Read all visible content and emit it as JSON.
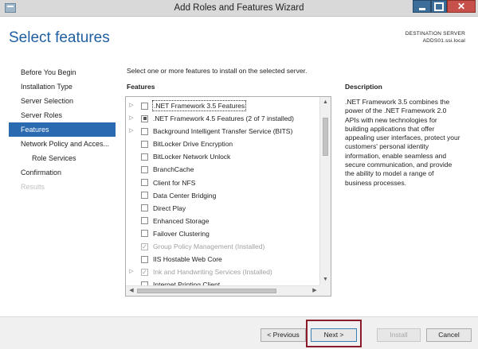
{
  "window": {
    "title": "Add Roles and Features Wizard",
    "close_glyph": "✕"
  },
  "header": {
    "title": "Select features",
    "destination_label": "DESTINATION SERVER",
    "destination_server": "ADDS01.ssi.local"
  },
  "nav": {
    "items": [
      {
        "label": "Before You Begin",
        "state": "normal"
      },
      {
        "label": "Installation Type",
        "state": "normal"
      },
      {
        "label": "Server Selection",
        "state": "normal"
      },
      {
        "label": "Server Roles",
        "state": "normal"
      },
      {
        "label": "Features",
        "state": "selected"
      },
      {
        "label": "Network Policy and Acces...",
        "state": "normal"
      },
      {
        "label": "Role Services",
        "state": "sub"
      },
      {
        "label": "Confirmation",
        "state": "normal"
      },
      {
        "label": "Results",
        "state": "disabled"
      }
    ]
  },
  "main": {
    "instruction": "Select one or more features to install on the selected server.",
    "features_heading": "Features",
    "features": [
      {
        "label": ".NET Framework 3.5 Features",
        "expandable": true,
        "check": "none",
        "focused": true,
        "installed": false
      },
      {
        "label": ".NET Framework 4.5 Features (2 of 7 installed)",
        "expandable": true,
        "check": "partial",
        "focused": false,
        "installed": false
      },
      {
        "label": "Background Intelligent Transfer Service (BITS)",
        "expandable": true,
        "check": "none",
        "focused": false,
        "installed": false
      },
      {
        "label": "BitLocker Drive Encryption",
        "expandable": false,
        "check": "none",
        "focused": false,
        "installed": false
      },
      {
        "label": "BitLocker Network Unlock",
        "expandable": false,
        "check": "none",
        "focused": false,
        "installed": false
      },
      {
        "label": "BranchCache",
        "expandable": false,
        "check": "none",
        "focused": false,
        "installed": false
      },
      {
        "label": "Client for NFS",
        "expandable": false,
        "check": "none",
        "focused": false,
        "installed": false
      },
      {
        "label": "Data Center Bridging",
        "expandable": false,
        "check": "none",
        "focused": false,
        "installed": false
      },
      {
        "label": "Direct Play",
        "expandable": false,
        "check": "none",
        "focused": false,
        "installed": false
      },
      {
        "label": "Enhanced Storage",
        "expandable": false,
        "check": "none",
        "focused": false,
        "installed": false
      },
      {
        "label": "Failover Clustering",
        "expandable": false,
        "check": "none",
        "focused": false,
        "installed": false
      },
      {
        "label": "Group Policy Management (Installed)",
        "expandable": false,
        "check": "checked",
        "focused": false,
        "installed": true
      },
      {
        "label": "IIS Hostable Web Core",
        "expandable": false,
        "check": "none",
        "focused": false,
        "installed": false
      },
      {
        "label": "Ink and Handwriting Services (Installed)",
        "expandable": true,
        "check": "checked",
        "focused": false,
        "installed": true
      },
      {
        "label": "Internet Printing Client",
        "expandable": false,
        "check": "none",
        "focused": false,
        "installed": false
      }
    ],
    "description_heading": "Description",
    "description_text": ".NET Framework 3.5 combines the power of the .NET Framework 2.0 APIs with new technologies for building applications that offer appealing user interfaces, protect your customers' personal identity information, enable seamless and secure communication, and provide the ability to model a range of business processes."
  },
  "footer": {
    "previous_label": "< Previous",
    "next_label": "Next >",
    "install_label": "Install",
    "cancel_label": "Cancel"
  },
  "colors": {
    "accent": "#2a6ab0",
    "title_blue": "#1f5fa0",
    "highlight_box": "#8b1a2b"
  }
}
